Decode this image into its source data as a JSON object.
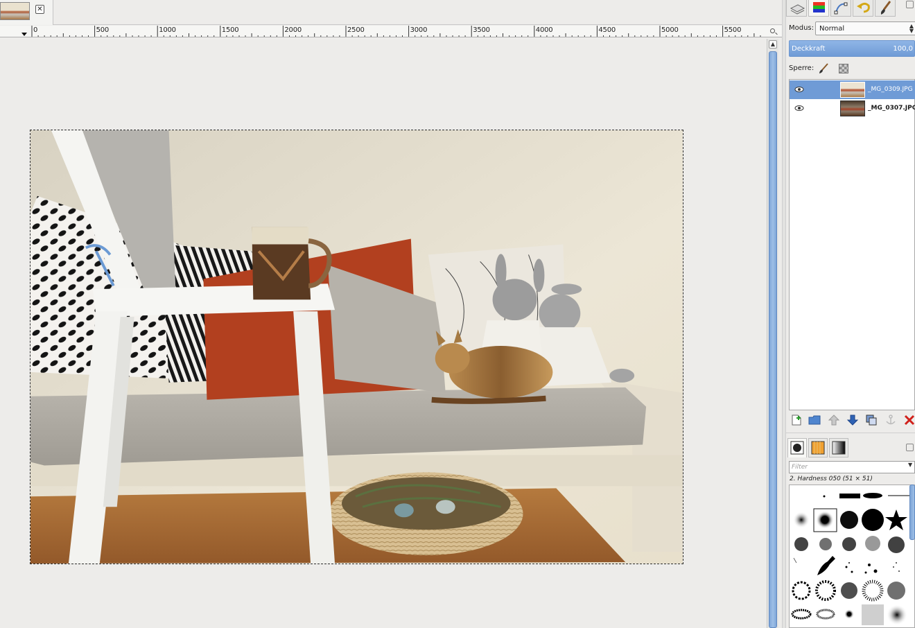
{
  "image_tab": {
    "close_symbol": "✕"
  },
  "ruler": {
    "ticks": [
      "0",
      "500",
      "1000",
      "1500",
      "2000",
      "2500",
      "3000",
      "3500",
      "4000",
      "4500",
      "5000",
      "5500"
    ]
  },
  "dock": {
    "tabs": [
      "layers-icon",
      "channels-icon",
      "paths-icon",
      "undo-history-icon",
      "brush-icon"
    ]
  },
  "layers_panel": {
    "mode_label": "Modus:",
    "mode_value": "Normal",
    "opacity_label": "Deckkraft",
    "opacity_value": "100,0",
    "lock_label": "Sperre:",
    "layers": [
      {
        "name": "_MG_0309.JPG",
        "visible": true,
        "selected": true
      },
      {
        "name": "_MG_0307.JPG",
        "visible": true,
        "selected": false
      }
    ]
  },
  "brushes_panel": {
    "filter_placeholder": "Filter",
    "selected_brush": "2. Hardness 050 (51 × 51)"
  },
  "colors": {
    "accent": "#6f9bd6",
    "danger": "#d0201a"
  }
}
